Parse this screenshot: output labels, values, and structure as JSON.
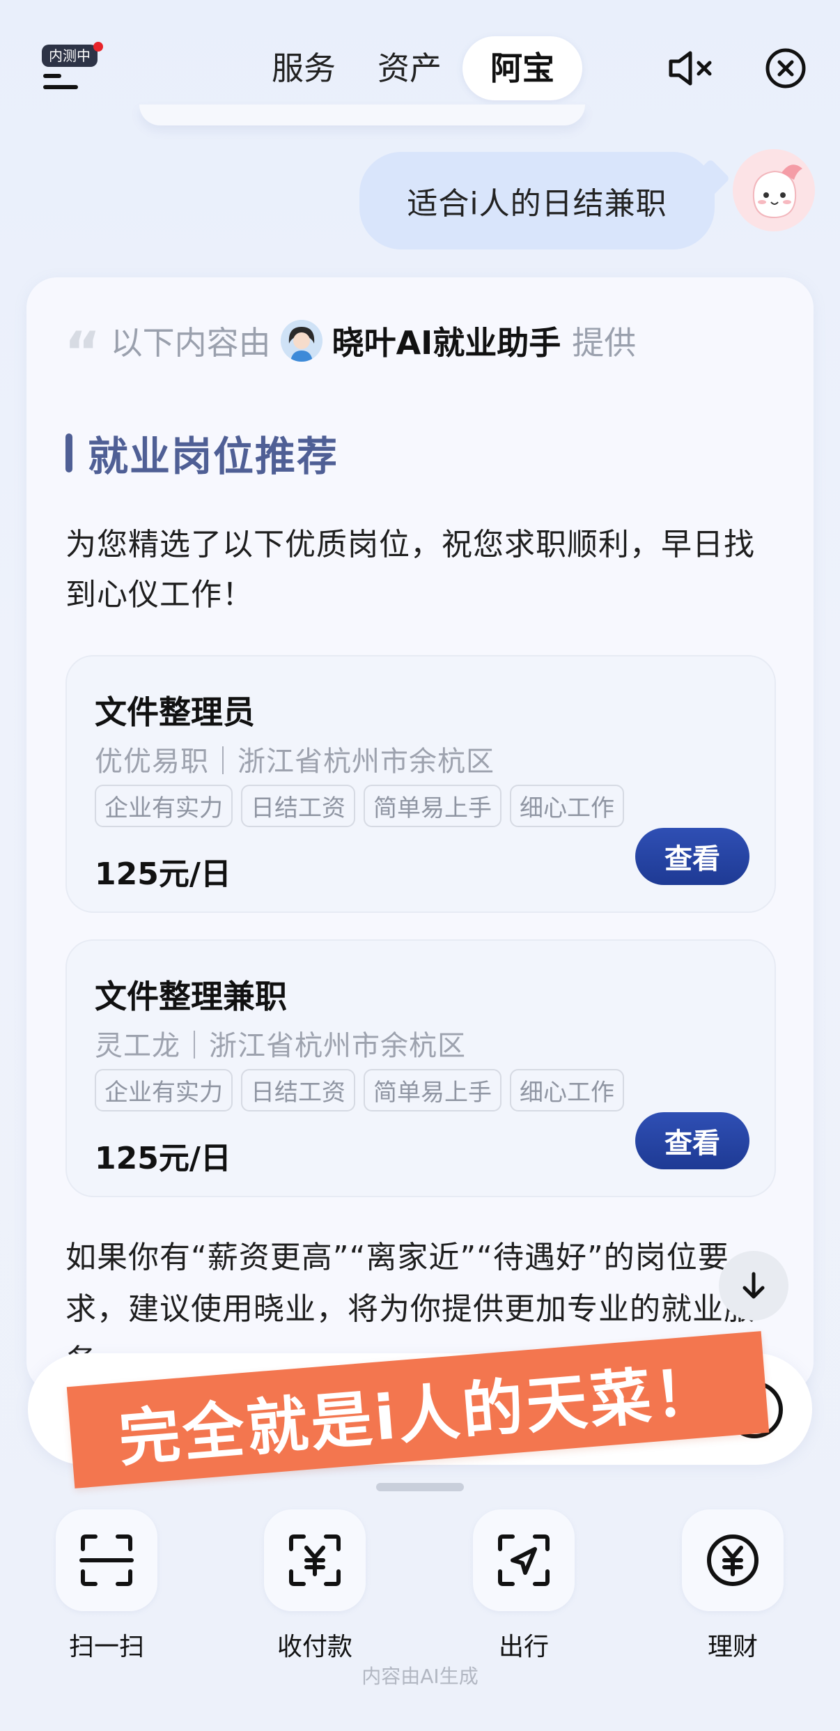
{
  "header": {
    "badge": "内测中",
    "tabs": [
      {
        "label": "服务",
        "active": false
      },
      {
        "label": "资产",
        "active": false
      },
      {
        "label": "阿宝",
        "active": true
      }
    ]
  },
  "chat": {
    "user_message": "适合i人的日结兼职"
  },
  "answer": {
    "provider_prefix": "以下内容由",
    "provider_name": "晓叶AI就业助手",
    "provider_suffix": "提供",
    "section_title": "就业岗位推荐",
    "intro": "为您精选了以下优质岗位，祝您求职顺利，早日找到心仪工作！",
    "jobs": [
      {
        "title": "文件整理员",
        "meta": "优优易职｜浙江省杭州市余杭区",
        "tags": [
          "企业有实力",
          "日结工资",
          "简单易上手",
          "细心工作"
        ],
        "salary": "125元/日",
        "button": "查看"
      },
      {
        "title": "文件整理兼职",
        "meta": "灵工龙｜浙江省杭州市余杭区",
        "tags": [
          "企业有实力",
          "日结工资",
          "简单易上手",
          "细心工作"
        ],
        "salary": "125元/日",
        "button": "查看"
      }
    ],
    "footer": "如果你有“薪资更高”“离家近”“待遇好”的岗位要求，建议使用晓业，将为你提供更加专业的就业服务。"
  },
  "banner": {
    "text": "完全就是i人的天菜！",
    "color": "#f3764f"
  },
  "quick_actions": [
    {
      "label": "扫一扫",
      "icon": "scan-icon"
    },
    {
      "label": "收付款",
      "icon": "payment-icon"
    },
    {
      "label": "出行",
      "icon": "travel-icon"
    },
    {
      "label": "理财",
      "icon": "finance-icon"
    }
  ],
  "disclaimer": "内容由AI生成",
  "colors": {
    "accent": "#2f4fb4",
    "section_title": "#4f5f95",
    "bubble": "#d9e5fb"
  }
}
